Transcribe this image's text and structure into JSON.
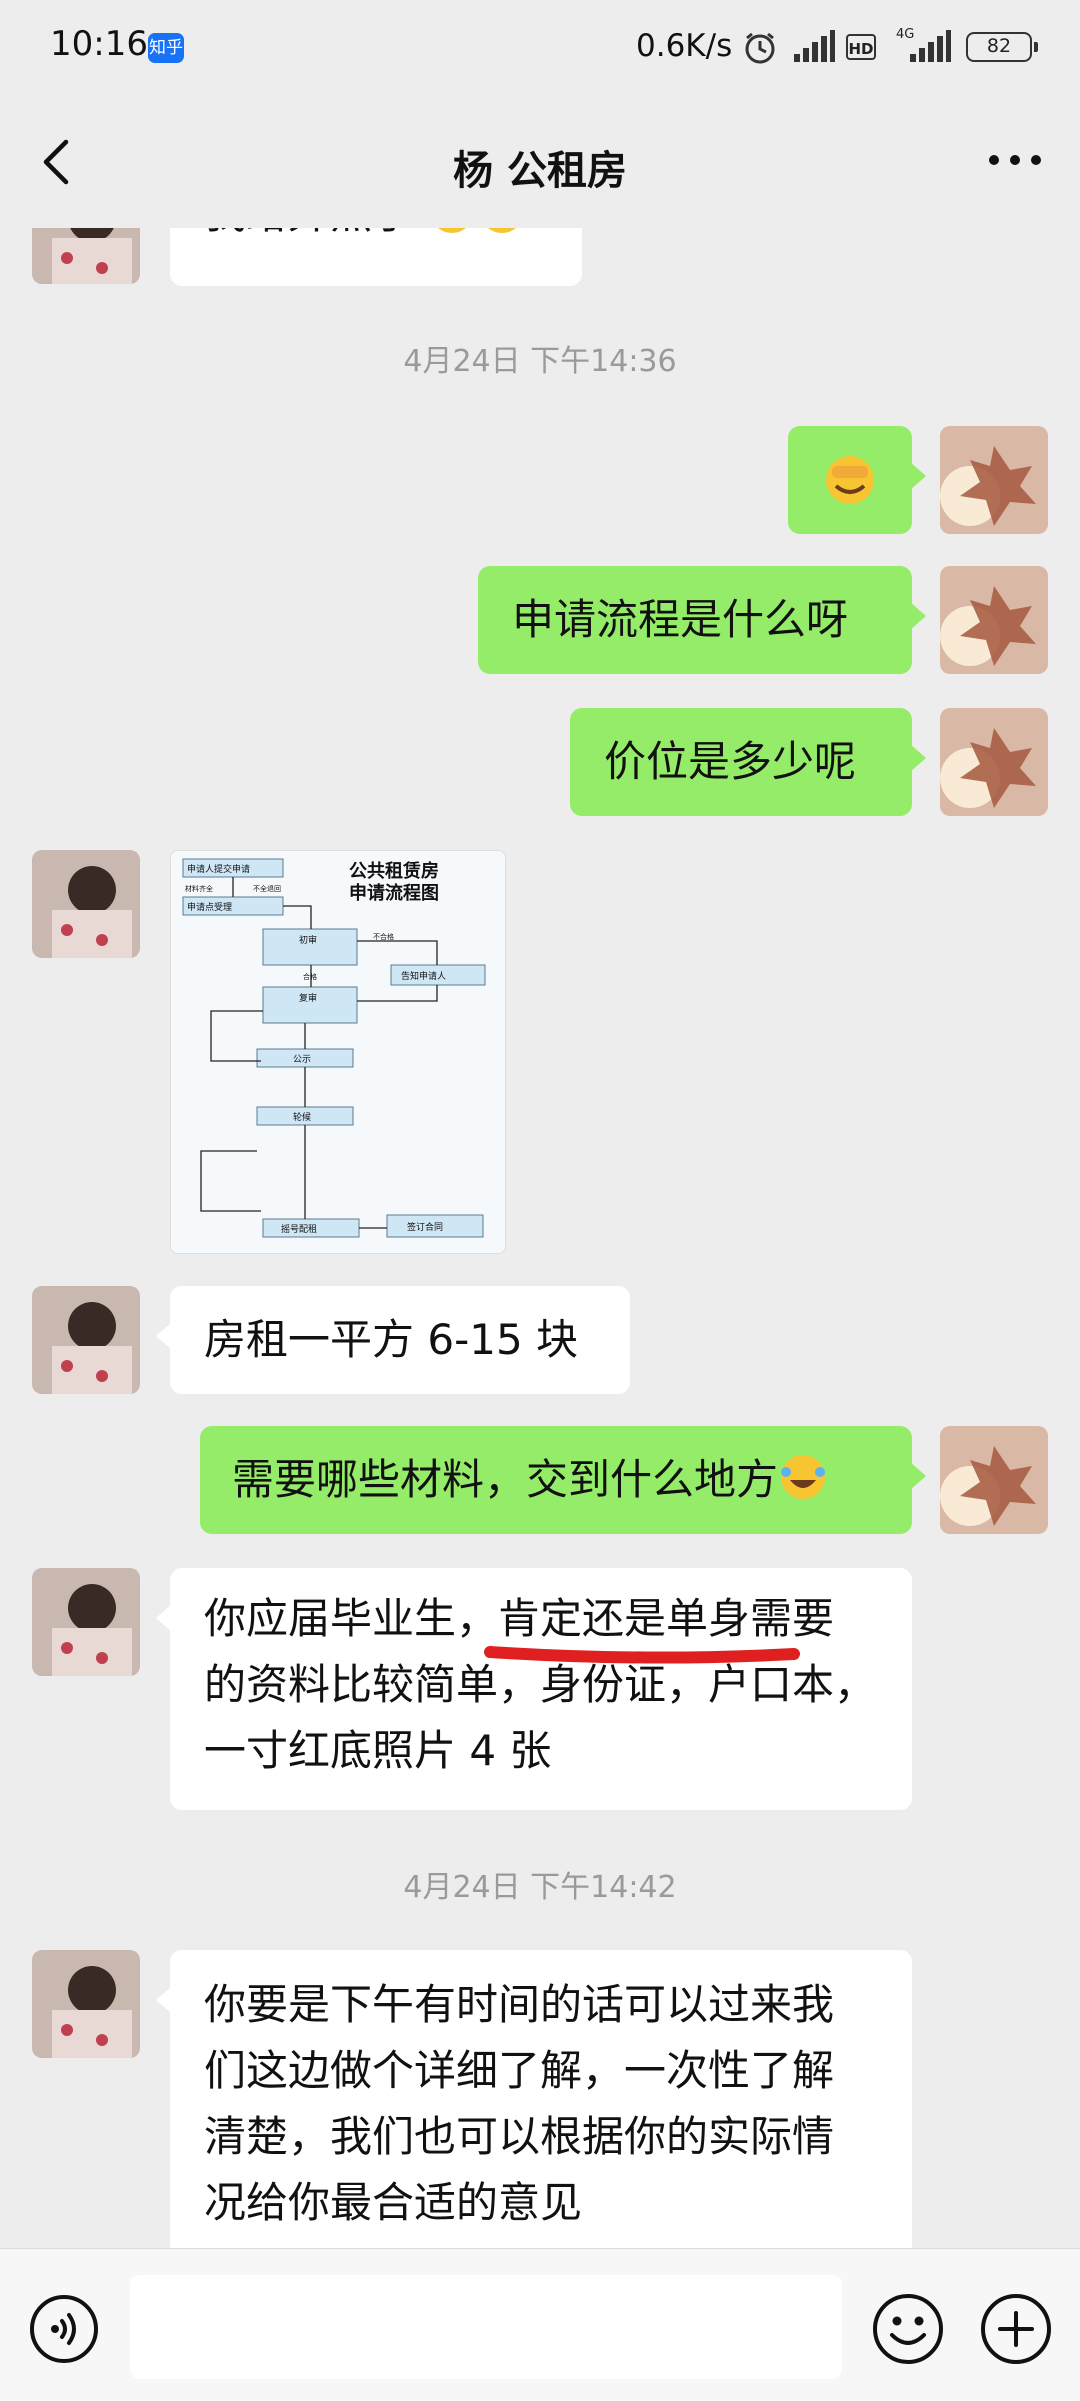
{
  "status_bar": {
    "time": "10:16",
    "app_badge": "知乎",
    "net_speed": "0.6K/s",
    "hd": "HD",
    "network": "4G",
    "battery": "82"
  },
  "header": {
    "title": "杨 公租房"
  },
  "messages": [
    {
      "side": "left",
      "text": "我给弄煞了",
      "emoji": "laugh-cry x2"
    },
    {
      "time": "4月24日 下午14:36"
    },
    {
      "side": "right",
      "emoji": "facepalm"
    },
    {
      "side": "right",
      "text": "申请流程是什么呀"
    },
    {
      "side": "right",
      "text": "价位是多少呢"
    },
    {
      "side": "left",
      "image": "flowchart"
    },
    {
      "side": "left",
      "text": "房租一平方 6-15 块"
    },
    {
      "side": "right",
      "text": "需要哪些材料，交到什么地方"
    },
    {
      "side": "left",
      "text": "你应届毕业生，肯定还是单身需要的资料比较简单，身份证，户口本，一寸红底照片 4 张"
    },
    {
      "time": "4月24日 下午14:42"
    },
    {
      "side": "left",
      "text": "你要是下午有时间的话可以过来我们这边做个详细了解，一次性了解清楚，我们也可以根据你的实际情况给你最合适的意见"
    }
  ],
  "msg": {
    "m1": "我给弄煞了",
    "t1": "4月24日 下午14:36",
    "m3": "申请流程是什么呀",
    "m4": "价位是多少呢",
    "m6": "房租一平方 6-15 块",
    "m7": "需要哪些材料，交到什么地方",
    "m8a": "你应届毕业生，",
    "m8b": "肯定还是单身",
    "m8c": "需要",
    "m8d": "的资料比较简单，身份证，户口本，",
    "m8e": "一寸红底照片 4 张",
    "t2": "4月24日 下午14:42",
    "m9a": "你要是下午有时间的话可以过来我",
    "m9b": "们这边做个详细了解，一次性了解",
    "m9c": "清楚，我们也可以根据你的实际情",
    "m9d": "况给你最合适的意见"
  },
  "flowchart": {
    "title1": "公共租赁房",
    "title2": "申请流程图",
    "n1": "申请人提交申请",
    "n2": "申请点受理",
    "n3": "初审",
    "n4": "复审",
    "n5": "公示",
    "n6": "轮候",
    "n7": "摇号配租",
    "n8": "签订合同",
    "n9": "告知申请人",
    "lbl_incomplete": "不全退回",
    "lbl_complete": "材料齐全",
    "lbl_fail": "不合格",
    "lbl_pass": "合格"
  },
  "colors": {
    "background": "#ededed",
    "bubble_self": "#95ec69",
    "bubble_other": "#ffffff",
    "underline": "#e02020"
  }
}
